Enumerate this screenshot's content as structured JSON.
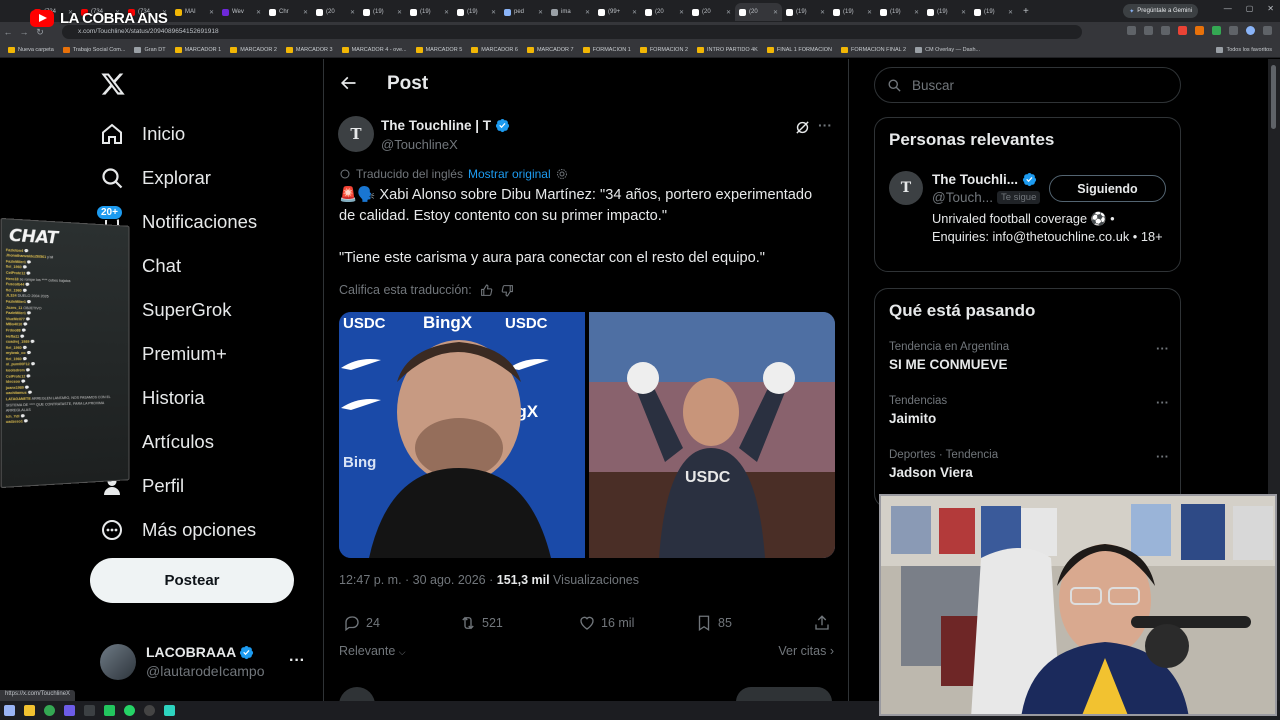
{
  "browser": {
    "tabs": [
      {
        "label": "(734",
        "color": "#ff0000"
      },
      {
        "label": "(734",
        "color": "#ff0000"
      },
      {
        "label": "(734",
        "color": "#ff0000"
      },
      {
        "label": "MAI",
        "color": "#f2b705"
      },
      {
        "label": "Wev",
        "color": "#6d28d9"
      },
      {
        "label": "Chr",
        "color": "#ffffff"
      },
      {
        "label": "(20",
        "color": "#ffffff"
      },
      {
        "label": "(19)",
        "color": "#ffffff"
      },
      {
        "label": "(19)",
        "color": "#ffffff"
      },
      {
        "label": "(19)",
        "color": "#ffffff"
      },
      {
        "label": "ped",
        "color": "#8ab4f8"
      },
      {
        "label": "ima",
        "color": "#9aa0a6"
      },
      {
        "label": "(99+",
        "color": "#ffffff"
      },
      {
        "label": "(20",
        "color": "#ffffff"
      },
      {
        "label": "(20",
        "color": "#ffffff"
      },
      {
        "label": "(20",
        "color": "#ffffff"
      },
      {
        "label": "(19)",
        "color": "#ffffff"
      },
      {
        "label": "(19)",
        "color": "#ffffff"
      },
      {
        "label": "(19)",
        "color": "#ffffff"
      },
      {
        "label": "(19)",
        "color": "#ffffff"
      },
      {
        "label": "(19)",
        "color": "#ffffff"
      }
    ],
    "active_tab_index": 15,
    "new_tab": "+",
    "gemini_button": "Pregúntale a Gemini",
    "url": "x.com/TouchlineX/status/2094089654152691918",
    "bookmarks": [
      {
        "label": "Nueva carpeta",
        "color": "#f2b705"
      },
      {
        "label": "Trabajo Social Com...",
        "color": "#e8710a"
      },
      {
        "label": "Gran DT",
        "color": "#9aa0a6"
      },
      {
        "label": "MARCADOR 1",
        "color": "#f2b705"
      },
      {
        "label": "MARCADOR 2",
        "color": "#f2b705"
      },
      {
        "label": "MARCADOR 3",
        "color": "#f2b705"
      },
      {
        "label": "MARCADOR 4 - ove...",
        "color": "#f2b705"
      },
      {
        "label": "MARCADOR 5",
        "color": "#f2b705"
      },
      {
        "label": "MARCADOR 6",
        "color": "#f2b705"
      },
      {
        "label": "MARCADOR 7",
        "color": "#f2b705"
      },
      {
        "label": "FORMACION 1",
        "color": "#f2b705"
      },
      {
        "label": "FORMACION 2",
        "color": "#f2b705"
      },
      {
        "label": "INTRO PARTIDO 4K",
        "color": "#f2b705"
      },
      {
        "label": "FINAL 1 FORMACION",
        "color": "#f2b705"
      },
      {
        "label": "FORMACION FINAL 2",
        "color": "#f2b705"
      },
      {
        "label": "CM Overlay — Dash...",
        "color": "#9aa0a6"
      }
    ],
    "all_bookmarks": "Todos los favoritos",
    "status_url": "https://x.com/TouchlineX"
  },
  "overlay": {
    "stream_name": "LA COBRA ANS",
    "chat_title": "CHAT",
    "chat_lines": [
      {
        "user": "Fazleton4",
        "msg": "💬"
      },
      {
        "user": "Jhonathanvaldez50561",
        "msg": "y'all"
      },
      {
        "user": "FazleMiler1",
        "msg": "💬"
      },
      {
        "user": "fiel_1960",
        "msg": "💬"
      },
      {
        "user": "CelProte12",
        "msg": "💬"
      },
      {
        "user": "Hero18",
        "msg": "se rompe los **** cubes bajatos"
      },
      {
        "user": "FuscoIb44",
        "msg": "💬"
      },
      {
        "user": "fiel_1960",
        "msg": "💬"
      },
      {
        "user": "JL324",
        "msg": "DUELO 2004 2026"
      },
      {
        "user": "FazleMiler1",
        "msg": "💬"
      },
      {
        "user": "Jozes_11",
        "msg": "OBJETIVO"
      },
      {
        "user": "FazleMiler1",
        "msg": "💬"
      },
      {
        "user": "ViuzMell77",
        "msg": "💬"
      },
      {
        "user": "MBo4010",
        "msg": "💬"
      },
      {
        "user": "Frdoo88",
        "msg": "💬"
      },
      {
        "user": "Hefta11",
        "msg": "💬"
      },
      {
        "user": "cuadrej_1989",
        "msg": "💬"
      },
      {
        "user": "fiel_1960",
        "msg": "💬"
      },
      {
        "user": "mybrak_co",
        "msg": "💬"
      },
      {
        "user": "fiel_1960",
        "msg": "💬"
      },
      {
        "user": "ol_pum00F12",
        "msg": "💬"
      },
      {
        "user": "koolsdrem",
        "msg": "💬"
      },
      {
        "user": "CelProte12",
        "msg": "💬"
      },
      {
        "user": "Idecsoo",
        "msg": "💬"
      },
      {
        "user": "juanx1980",
        "msg": "💬"
      },
      {
        "user": "uachitamus",
        "msg": "💬"
      },
      {
        "user": "LATAGANETE",
        "msg": "ARREGLEN LANTARO, NOS PASAMOS CON EL"
      },
      {
        "user": "",
        "msg": "SISTEMA DE **** QUE CONTRATASTE, PARA LA PROXIMA"
      },
      {
        "user": "",
        "msg": "ARREGLALAS"
      },
      {
        "user": "tch_Ydl",
        "msg": "💬"
      },
      {
        "user": "uadzeso1",
        "msg": "💬"
      }
    ]
  },
  "sidebar": {
    "nav": [
      {
        "label": "Inicio",
        "icon": "home-icon"
      },
      {
        "label": "Explorar",
        "icon": "search-icon"
      },
      {
        "label": "Notificaciones",
        "icon": "bell-icon"
      },
      {
        "label": "Chat",
        "icon": "chat-icon"
      },
      {
        "label": "SuperGrok",
        "icon": "grok-icon"
      },
      {
        "label": "Premium+",
        "icon": "verified-icon"
      },
      {
        "label": "Historia",
        "icon": "bookmark-icon"
      },
      {
        "label": "Artículos",
        "icon": "articles-icon"
      },
      {
        "label": "Perfil",
        "icon": "person-icon"
      },
      {
        "label": "Más opciones",
        "icon": "more-circle-icon"
      }
    ],
    "notif_badge": "20+",
    "post_button": "Postear",
    "account": {
      "name": "LACOBRAAA",
      "handle": "@lautarodeIcampo"
    }
  },
  "main": {
    "header_title": "Post",
    "author": {
      "name": "The Touchline | T",
      "handle": "@TouchlineX",
      "avatar_letter": "T"
    },
    "translated_label": "Traducido del inglés",
    "show_original": "Mostrar original",
    "tweet_text": "🚨🗣️ Xabi Alonso sobre Dibu Martínez: \"34 años, portero experimentado de calidad. Estoy contento con su primer impacto.\"\n\n\"Tiene este carisma y aura para conectar con el resto del equipo.\"",
    "rate_translation": "Califica esta traducción:",
    "timestamp": "12:47 p. m. · 30 ago. 2026 · ",
    "views_count": "151,3 mil",
    "views_label": " Visualizaciones",
    "actions": {
      "replies": "24",
      "reposts": "521",
      "likes": "16 mil",
      "bookmarks": "85"
    },
    "sort_label": "Relevante",
    "quotes_label": "Ver citas"
  },
  "right": {
    "search_placeholder": "Buscar",
    "relevant_title": "Personas relevantes",
    "relevant_person": {
      "name": "The Touchli...",
      "handle": "@Touch...",
      "follows_you": "Te sigue",
      "following_button": "Siguiendo",
      "bio": "Unrivaled football coverage ⚽ • Enquiries: info@thetouchline.co.uk • 18+",
      "avatar_letter": "T"
    },
    "trending_title": "Qué está pasando",
    "trends": [
      {
        "context": "Tendencia en Argentina",
        "name": "SI ME CONMUEVE"
      },
      {
        "context": "Tendencias",
        "name": "Jaimito"
      },
      {
        "context": "Deportes · Tendencia",
        "name": "Jadson Viera"
      }
    ]
  },
  "colors": {
    "accent": "#1d9bf0",
    "background": "#000000",
    "muted": "#71767b",
    "text": "#e7e9ea"
  }
}
